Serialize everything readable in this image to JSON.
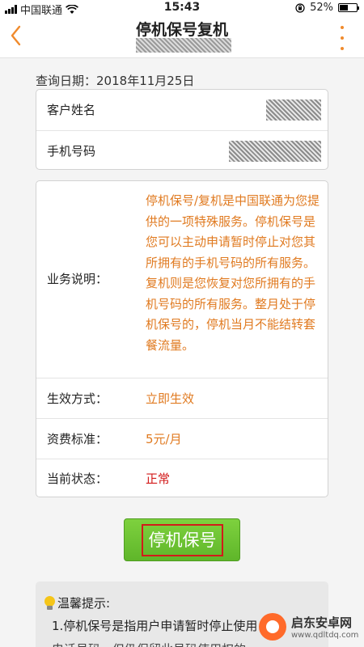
{
  "status_bar": {
    "carrier": "中国联通",
    "time": "15:43",
    "battery": "52%",
    "battery_level": 0.52
  },
  "nav": {
    "title": "停机保号复机"
  },
  "query": {
    "label": "查询日期：",
    "date": "2018年11月25日"
  },
  "customer": {
    "name_label": "客户姓名",
    "phone_label": "手机号码"
  },
  "service": {
    "desc_label": "业务说明：",
    "desc_text": "停机保号/复机是中国联通为您提供的一项特殊服务。停机保号是您可以主动申请暂时停止对您其所拥有的手机号码的所有服务。复机则是您恢复对您所拥有的手机号码的所有服务。整月处于停机保号的，停机当月不能结转套餐流量。",
    "effect_label": "生效方式：",
    "effect_value": "立即生效",
    "fee_label": "资费标准：",
    "fee_value": "5元/月",
    "status_label": "当前状态：",
    "status_value": "正常"
  },
  "action": {
    "button_label": "停机保号"
  },
  "tips": {
    "title": "温馨提示:",
    "line1": "1.停机保号是指用户申请暂时停止使用",
    "line2": "电话号码，但仍保留此号码使用权的"
  },
  "watermark": {
    "name": "启东安卓网",
    "url": "www.qdltdq.com"
  },
  "colors": {
    "accent": "#f08a2c",
    "value_text": "#e07a20",
    "status_normal": "#d21a1a",
    "button_green": "#6cc232"
  }
}
